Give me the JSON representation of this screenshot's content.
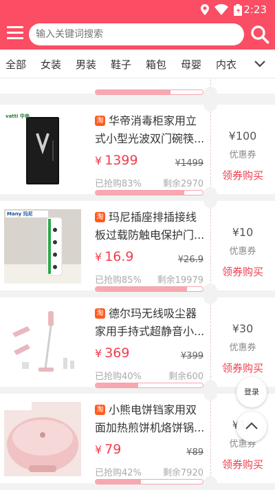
{
  "status_bar": {
    "time": "2:23"
  },
  "header": {
    "search_placeholder": "输入关键词搜索"
  },
  "categories": [
    "全部",
    "女装",
    "男装",
    "鞋子",
    "箱包",
    "母婴",
    "内衣"
  ],
  "badge_label": "淘",
  "products": [
    {
      "title": "华帝消毒柜家用立式小型光波双门碗筷...",
      "price": "1399",
      "original_price": "1499",
      "sold_text": "已抢购83%",
      "sold_pct": 83,
      "remaining_text": "剩余2970",
      "coupon_value": "¥100",
      "coupon_label": "优惠券",
      "coupon_button": "领券购买",
      "brand_mark": "vatti 华帝"
    },
    {
      "title": "玛尼插座排插接线板过载防触电保护门...",
      "price": "16.9",
      "original_price": "26.9",
      "sold_text": "已抢购85%",
      "sold_pct": 85,
      "remaining_text": "剩余19979",
      "coupon_value": "¥10",
      "coupon_label": "优惠券",
      "coupon_button": "领券购买",
      "brand_mark": "Many 玛尼"
    },
    {
      "title": "德尔玛无线吸尘器家用手持式超静音小...",
      "price": "369",
      "original_price": "399",
      "sold_text": "已抢购40%",
      "sold_pct": 40,
      "remaining_text": "剩余600",
      "coupon_value": "¥30",
      "coupon_label": "优惠券",
      "coupon_button": "领券购买",
      "brand_mark": ""
    },
    {
      "title": "小熊电饼铛家用双面加热煎饼机烙饼锅...",
      "price": "79",
      "original_price": "89",
      "sold_text": "已抢购42%",
      "sold_pct": 42,
      "remaining_text": "剩余7920",
      "coupon_value": "¥10",
      "coupon_label": "优惠券",
      "coupon_button": "领券购买",
      "brand_mark": ""
    }
  ],
  "fab": {
    "login": "登录"
  },
  "colors": {
    "accent": "#fb4d63",
    "price": "#f23c4c",
    "badge": "#ff5b1f"
  }
}
